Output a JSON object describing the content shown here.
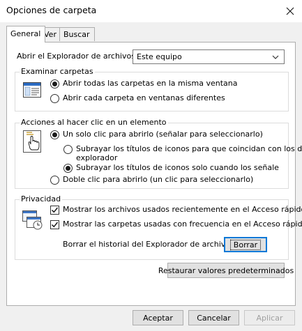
{
  "window": {
    "title": "Opciones de carpeta"
  },
  "tabs": [
    {
      "label": "General",
      "active": true
    },
    {
      "label": "Ver",
      "active": false
    },
    {
      "label": "Buscar",
      "active": false
    }
  ],
  "open_explorer": {
    "label": "Abrir el Explorador de archivos en:",
    "value": "Este equipo"
  },
  "browse": {
    "legend": "Examinar carpetas",
    "options": [
      {
        "label": "Abrir todas las carpetas en la misma ventana",
        "selected": true
      },
      {
        "label": "Abrir cada carpeta en ventanas diferentes",
        "selected": false
      }
    ]
  },
  "click": {
    "legend": "Acciones al hacer clic en un elemento",
    "single": {
      "label": "Un solo clic para abrirlo (señalar para seleccionarlo)",
      "selected": true
    },
    "underline_always": {
      "line1": "Subrayar los títulos de iconos para que coincidan con los del",
      "line2": "explorador",
      "selected": false
    },
    "underline_hover": {
      "label": "Subrayar los títulos de iconos solo cuando los señale",
      "selected": true
    },
    "double": {
      "label": "Doble clic para abrirlo (un clic para seleccionarlo)",
      "selected": false
    }
  },
  "privacy": {
    "legend": "Privacidad",
    "recent_files": {
      "label": "Mostrar los archivos usados recientemente en el Acceso rápido",
      "checked": true
    },
    "frequent_folders": {
      "label": "Mostrar las carpetas usadas con frecuencia en el Acceso rápido",
      "checked": true
    },
    "clear_history": {
      "label": "Borrar el historial del Explorador de archivos",
      "button": "Borrar"
    }
  },
  "restore_button": "Restaurar valores predeterminados",
  "footer": {
    "ok": "Aceptar",
    "cancel": "Cancelar",
    "apply": "Aplicar"
  }
}
